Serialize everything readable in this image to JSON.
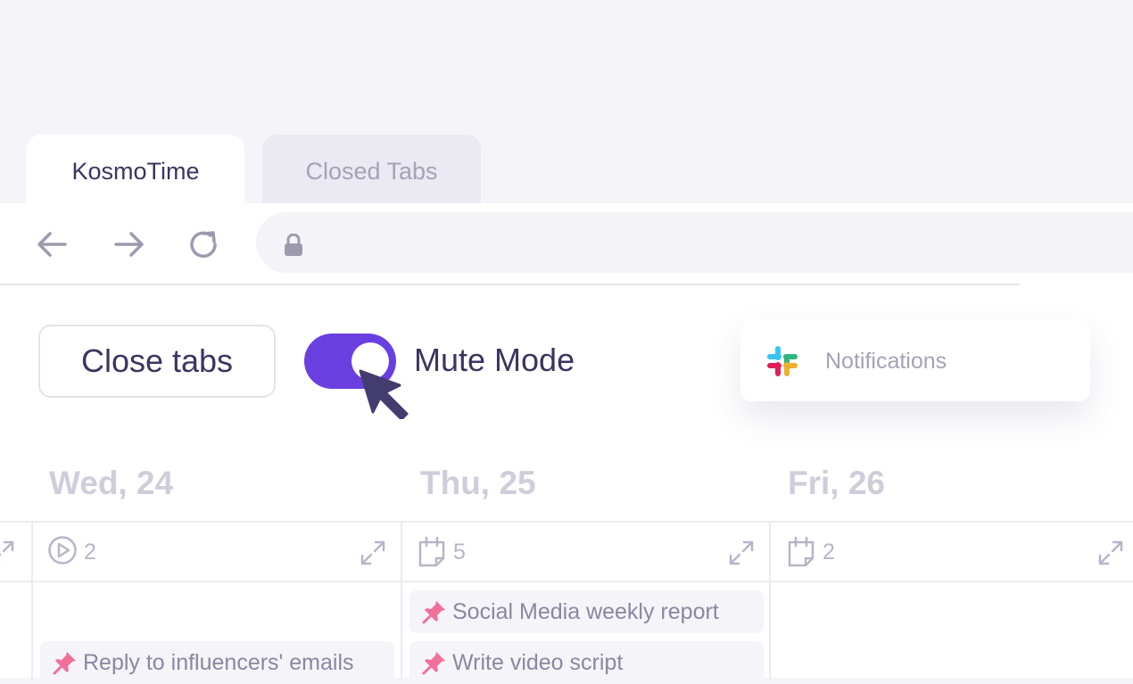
{
  "tabs": [
    {
      "label": "KosmoTime",
      "active": true
    },
    {
      "label": "Closed Tabs",
      "active": false
    }
  ],
  "toolbar": {
    "close_tabs_label": "Close tabs",
    "mute_mode_label": "Mute Mode",
    "mute_mode_on": true
  },
  "notifications": {
    "label": "Notifications",
    "icon": "slack-icon"
  },
  "days": [
    {
      "label": "Wed, 24",
      "count": "2",
      "count_icon": "play-circle-icon",
      "tasks": [
        "Reply to influencers' emails"
      ]
    },
    {
      "label": "Thu, 25",
      "count": "5",
      "count_icon": "calendar-icon",
      "tasks": [
        "Social Media weekly report",
        "Write video script"
      ]
    },
    {
      "label": "Fri, 26",
      "count": "2",
      "count_icon": "calendar-icon",
      "tasks": []
    }
  ],
  "colors": {
    "accent": "#6a3fe0",
    "text": "#3b3561",
    "muted": "#a5a2b7",
    "pin": "#f0709a"
  }
}
